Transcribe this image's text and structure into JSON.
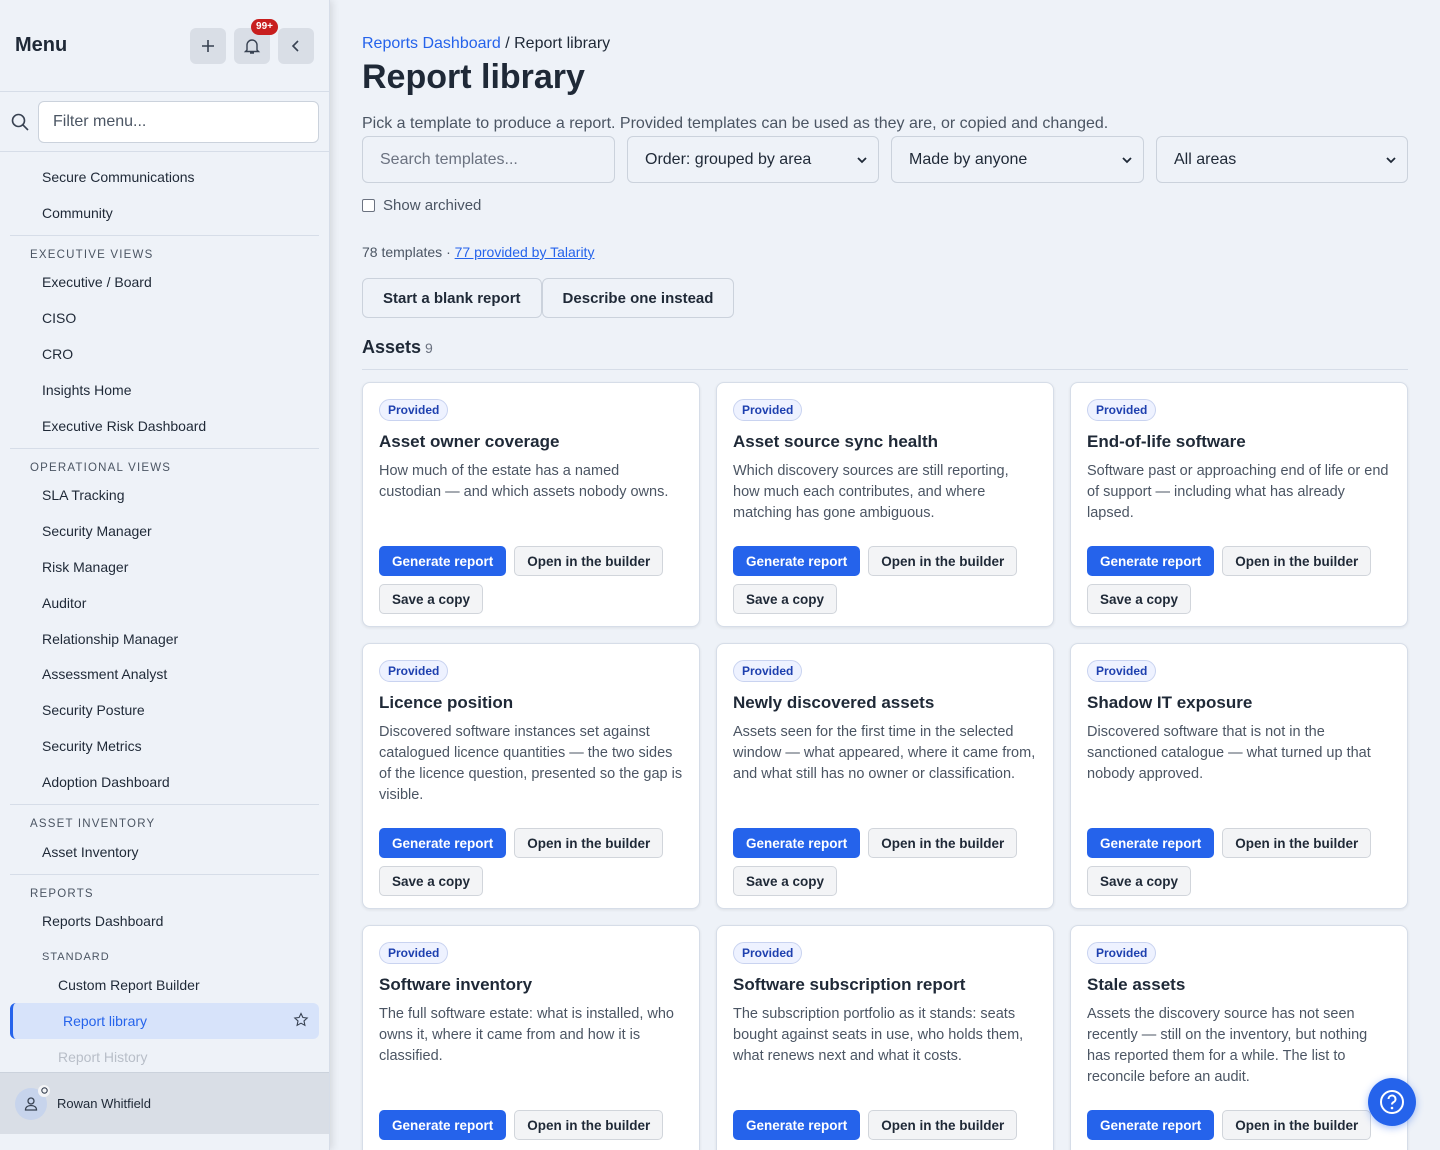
{
  "sidebar": {
    "title": "Menu",
    "notifications_badge": "99+",
    "filter_placeholder": "Filter menu...",
    "top_items": [
      "Secure Communications",
      "Community"
    ],
    "sections": [
      {
        "title": "EXECUTIVE VIEWS",
        "items": [
          "Executive / Board",
          "CISO",
          "CRO",
          "Insights Home",
          "Executive Risk Dashboard"
        ]
      },
      {
        "title": "OPERATIONAL VIEWS",
        "items": [
          "SLA Tracking",
          "Security Manager",
          "Risk Manager",
          "Auditor",
          "Relationship Manager",
          "Assessment Analyst",
          "Security Posture",
          "Security Metrics",
          "Adoption Dashboard"
        ]
      },
      {
        "title": "ASSET INVENTORY",
        "items": [
          "Asset Inventory"
        ]
      },
      {
        "title": "REPORTS",
        "items": [
          "Reports Dashboard"
        ]
      }
    ],
    "reports_subsection": "STANDARD",
    "reports_sub_items": [
      "Custom Report Builder",
      "Report library",
      "Report History"
    ],
    "active_item": "Report library",
    "user_name": "Rowan Whitfield"
  },
  "breadcrumb": {
    "parent": "Reports Dashboard",
    "separator": "/",
    "current": "Report library"
  },
  "page": {
    "title": "Report library",
    "intro": "Pick a template to produce a report. Provided templates can be used as they are, or copied and changed."
  },
  "controls": {
    "search_placeholder": "Search templates...",
    "order": "Order: grouped by area",
    "made_by": "Made by anyone",
    "areas": "All areas",
    "show_archived": "Show archived"
  },
  "counts": {
    "total": "78 templates",
    "sep": "·",
    "provided_link": "77 provided by Talarity"
  },
  "actions": {
    "blank": "Start a blank report",
    "describe": "Describe one instead"
  },
  "section": {
    "title": "Assets",
    "count": "9"
  },
  "card_labels": {
    "badge": "Provided",
    "generate": "Generate report",
    "open": "Open in the builder",
    "copy": "Save a copy"
  },
  "cards": [
    {
      "title": "Asset owner coverage",
      "desc": "How much of the estate has a named custodian — and which assets nobody owns."
    },
    {
      "title": "Asset source sync health",
      "desc": "Which discovery sources are still reporting, how much each contributes, and where matching has gone ambiguous."
    },
    {
      "title": "End-of-life software",
      "desc": "Software past or approaching end of life or end of support — including what has already lapsed."
    },
    {
      "title": "Licence position",
      "desc": "Discovered software instances set against catalogued licence quantities — the two sides of the licence question, presented so the gap is visible."
    },
    {
      "title": "Newly discovered assets",
      "desc": "Assets seen for the first time in the selected window — what appeared, where it came from, and what still has no owner or classification."
    },
    {
      "title": "Shadow IT exposure",
      "desc": "Discovered software that is not in the sanctioned catalogue — what turned up that nobody approved."
    },
    {
      "title": "Software inventory",
      "desc": "The full software estate: what is installed, who owns it, where it came from and how it is classified."
    },
    {
      "title": "Software subscription report",
      "desc": "The subscription portfolio as it stands: seats bought against seats in use, who holds them, what renews next and what it costs."
    },
    {
      "title": "Stale assets",
      "desc": "Assets the discovery source has not seen recently — still on the inventory, but nothing has reported them for a while. The list to reconcile before an audit."
    }
  ]
}
